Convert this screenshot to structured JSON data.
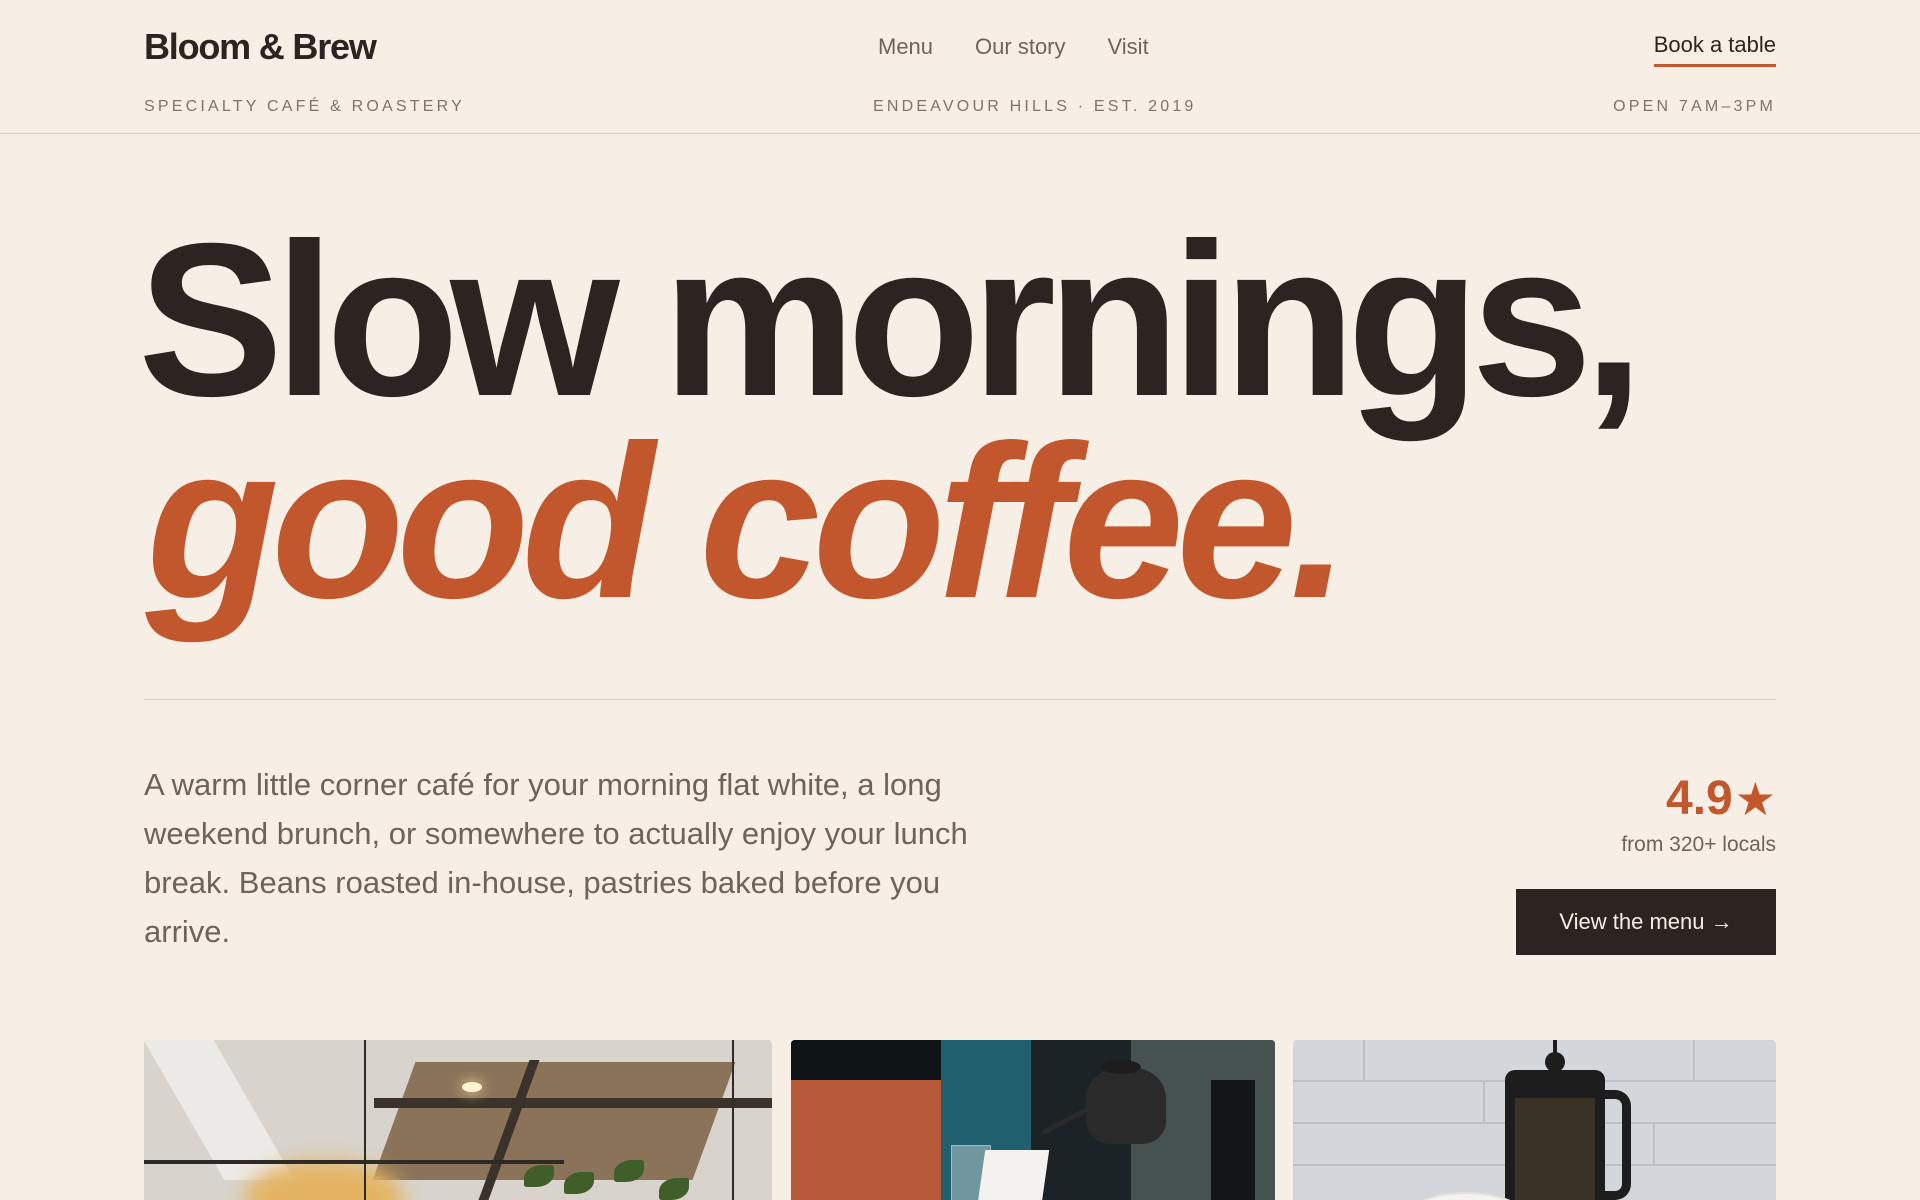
{
  "header": {
    "brand": "Bloom & Brew",
    "nav": [
      "Menu",
      "Our story",
      "Visit"
    ],
    "cta": "Book a table",
    "tagline": "SPECIALTY CAFÉ & ROASTERY",
    "location": "ENDEAVOUR HILLS · EST. 2019",
    "hours": "OPEN 7AM–3PM"
  },
  "hero": {
    "line1": "Slow mornings,",
    "line2": "good coffee."
  },
  "intro": {
    "text": "A warm little corner café for your morning flat white, a long weekend brunch, or somewhere to actually enjoy your lunch break. Beans roasted in-house, pastries baked before you arrive."
  },
  "rating": {
    "value": "4.9",
    "star": "★",
    "sub": "from 320+ locals"
  },
  "cta": {
    "label": "View the menu →"
  },
  "colors": {
    "background": "#f7efe5",
    "ink": "#2b2420",
    "accent": "#c2572d",
    "muted": "#6e635b"
  },
  "photos": [
    "cafe-interior-photo",
    "pour-over-photo",
    "french-press-photo"
  ]
}
